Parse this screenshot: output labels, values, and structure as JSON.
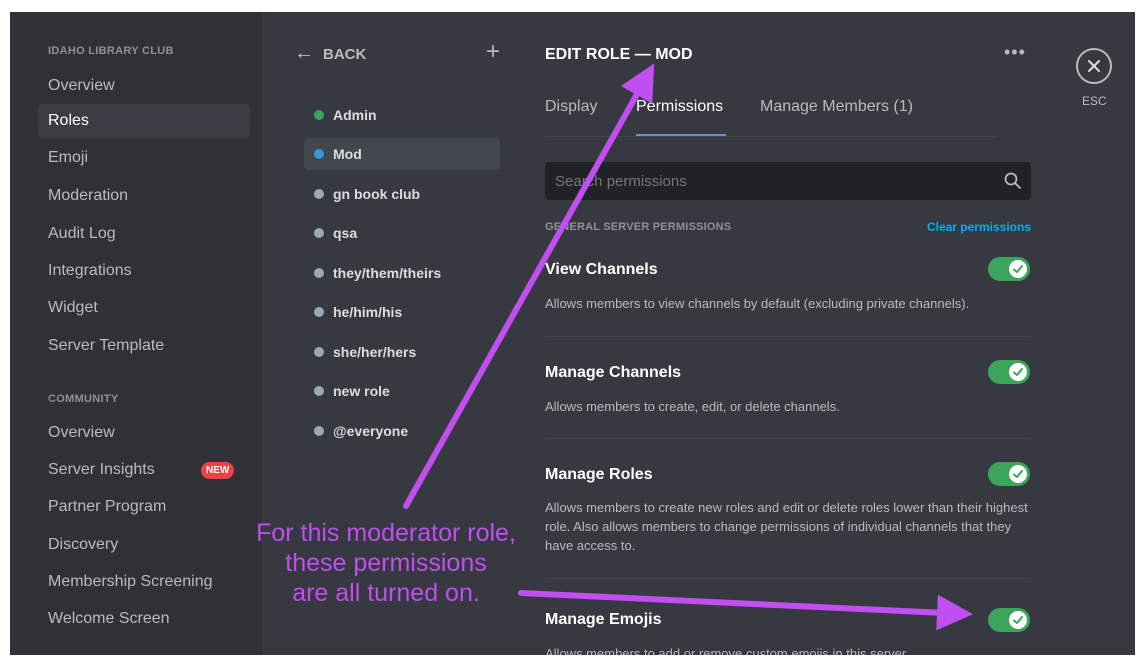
{
  "sidebar": {
    "server_name": "IDAHO LIBRARY CLUB",
    "server_items": [
      "Overview",
      "Roles",
      "Emoji",
      "Moderation",
      "Audit Log",
      "Integrations",
      "Widget",
      "Server Template"
    ],
    "selected_item": "Roles",
    "community_header": "COMMUNITY",
    "community_items": [
      "Overview",
      "Server Insights",
      "Partner Program",
      "Discovery",
      "Membership Screening",
      "Welcome Screen"
    ],
    "new_badge": "NEW"
  },
  "roles_list": {
    "back_label": "BACK",
    "add_icon": "plus-icon",
    "roles": [
      {
        "name": "Admin",
        "color": "#3ba55c"
      },
      {
        "name": "Mod",
        "color": "#3498db"
      },
      {
        "name": "gn book club",
        "color": "#99aab5"
      },
      {
        "name": "qsa",
        "color": "#99aab5"
      },
      {
        "name": "they/them/theirs",
        "color": "#99aab5"
      },
      {
        "name": "he/him/his",
        "color": "#99aab5"
      },
      {
        "name": "she/her/hers",
        "color": "#99aab5"
      },
      {
        "name": "new role",
        "color": "#99aab5"
      },
      {
        "name": "@everyone",
        "color": "#99aab5"
      }
    ],
    "selected_role": "Mod"
  },
  "edit_role": {
    "title": "EDIT ROLE — MOD",
    "tabs": [
      "Display",
      "Permissions",
      "Manage Members (1)"
    ],
    "active_tab": "Permissions",
    "search_placeholder": "Search permissions",
    "section_header": "GENERAL SERVER PERMISSIONS",
    "clear_label": "Clear permissions",
    "permissions": [
      {
        "title": "View Channels",
        "desc": "Allows members to view channels by default (excluding private channels).",
        "enabled": true
      },
      {
        "title": "Manage Channels",
        "desc": "Allows members to create, edit, or delete channels.",
        "enabled": true
      },
      {
        "title": "Manage Roles",
        "desc": "Allows members to create new roles and edit or delete roles lower than their highest role. Also allows members to change permissions of individual channels that they have access to.",
        "enabled": true
      },
      {
        "title": "Manage Emojis",
        "desc": "Allows members to add or remove custom emojis in this server.",
        "enabled": true
      }
    ]
  },
  "close": {
    "esc_label": "ESC"
  },
  "annotation": {
    "lines": [
      "For this moderator role,",
      "these permissions",
      "are all turned on."
    ],
    "color": "#c04ef0"
  },
  "colors": {
    "background": "#36393f",
    "sidebar": "#2f3136",
    "toggle_on": "#3ba55c",
    "link": "#00b0f4",
    "accent": "#7289da"
  }
}
